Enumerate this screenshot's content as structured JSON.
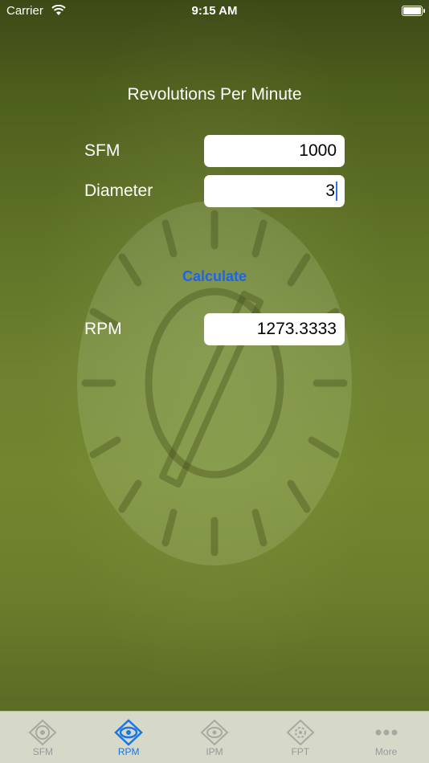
{
  "status_bar": {
    "carrier": "Carrier",
    "time": "9:15 AM"
  },
  "page": {
    "title": "Revolutions Per Minute",
    "sfm": {
      "label": "SFM",
      "value": "1000"
    },
    "diameter": {
      "label": "Diameter",
      "value": "3"
    },
    "calculate_label": "Calculate",
    "rpm": {
      "label": "RPM",
      "value": "1273.3333"
    }
  },
  "tabs": [
    {
      "label": "SFM",
      "icon": "sfm-icon",
      "active": false
    },
    {
      "label": "RPM",
      "icon": "rpm-icon",
      "active": true
    },
    {
      "label": "IPM",
      "icon": "ipm-icon",
      "active": false
    },
    {
      "label": "FPT",
      "icon": "fpt-icon",
      "active": false
    },
    {
      "label": "More",
      "icon": "more-icon",
      "active": false
    }
  ],
  "colors": {
    "accent": "#1976e8",
    "calculate": "#1e64e6",
    "tab_bar": "#d6d8c8"
  }
}
